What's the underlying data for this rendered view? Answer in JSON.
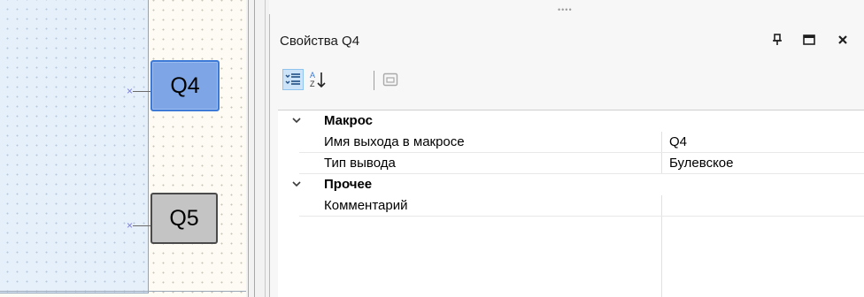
{
  "canvas": {
    "blocks": [
      {
        "label": "Q4",
        "state": "selected"
      },
      {
        "label": "Q5",
        "state": "normal"
      }
    ],
    "pin_marker": "×"
  },
  "splitter": {
    "grip": "••••"
  },
  "properties": {
    "title": "Свойства Q4",
    "titlebar_icons": [
      "pin-icon",
      "maximize-icon",
      "close-icon"
    ],
    "toolbar_icons": [
      "categorized-icon",
      "sort-alphabetical-icon",
      "property-pages-icon"
    ],
    "categories": [
      {
        "label": "Макрос",
        "expanded": true,
        "rows": [
          {
            "name": "Имя выхода в макросе",
            "value": "Q4"
          },
          {
            "name": "Тип вывода",
            "value": "Булевское"
          }
        ]
      },
      {
        "label": "Прочее",
        "expanded": true,
        "rows": [
          {
            "name": "Комментарий",
            "value": ""
          }
        ]
      }
    ]
  }
}
